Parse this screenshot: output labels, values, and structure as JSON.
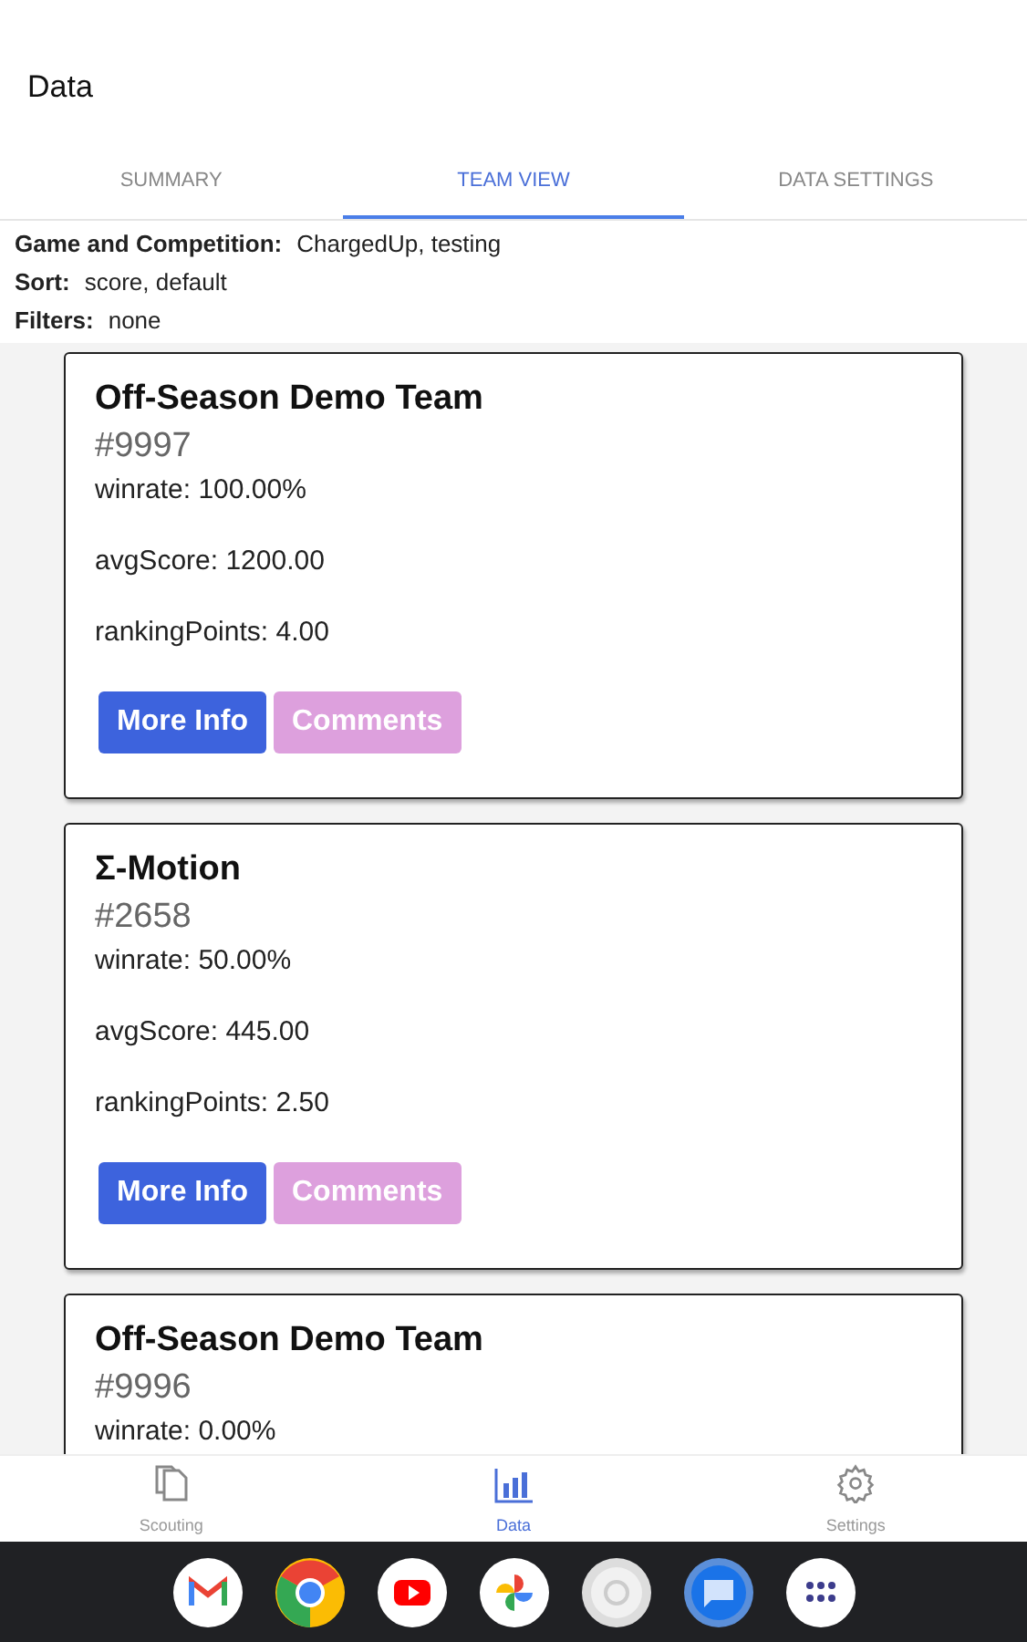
{
  "app_bar": {
    "title": "Data"
  },
  "tabs": [
    {
      "label": "SUMMARY",
      "selected": false
    },
    {
      "label": "TEAM VIEW",
      "selected": true
    },
    {
      "label": "DATA SETTINGS",
      "selected": false
    }
  ],
  "info": [
    {
      "label": "Game and Competition:",
      "value": "ChargedUp, testing"
    },
    {
      "label": "Sort:",
      "value": "score, default"
    },
    {
      "label": "Filters:",
      "value": "none"
    }
  ],
  "teams": [
    {
      "name": "Off-Season Demo Team",
      "number": "#9997",
      "stats": [
        "winrate: 100.00%",
        "avgScore: 1200.00",
        "rankingPoints: 4.00"
      ],
      "buttons": [
        {
          "label": "More Info",
          "kind": "primary"
        },
        {
          "label": "Comments",
          "kind": "secondary"
        }
      ]
    },
    {
      "name": "Σ-Motion",
      "number": "#2658",
      "stats": [
        "winrate: 50.00%",
        "avgScore: 445.00",
        "rankingPoints: 2.50"
      ],
      "buttons": [
        {
          "label": "More Info",
          "kind": "primary"
        },
        {
          "label": "Comments",
          "kind": "secondary"
        }
      ]
    },
    {
      "name": "Off-Season Demo Team",
      "number": "#9996",
      "stats": [
        "winrate: 0.00%"
      ]
    }
  ],
  "bottom_nav": [
    {
      "label": "Scouting",
      "kind": "scouting",
      "selected": false
    },
    {
      "label": "Data",
      "kind": "data",
      "selected": true
    },
    {
      "label": "Settings",
      "kind": "settings",
      "selected": false
    }
  ]
}
